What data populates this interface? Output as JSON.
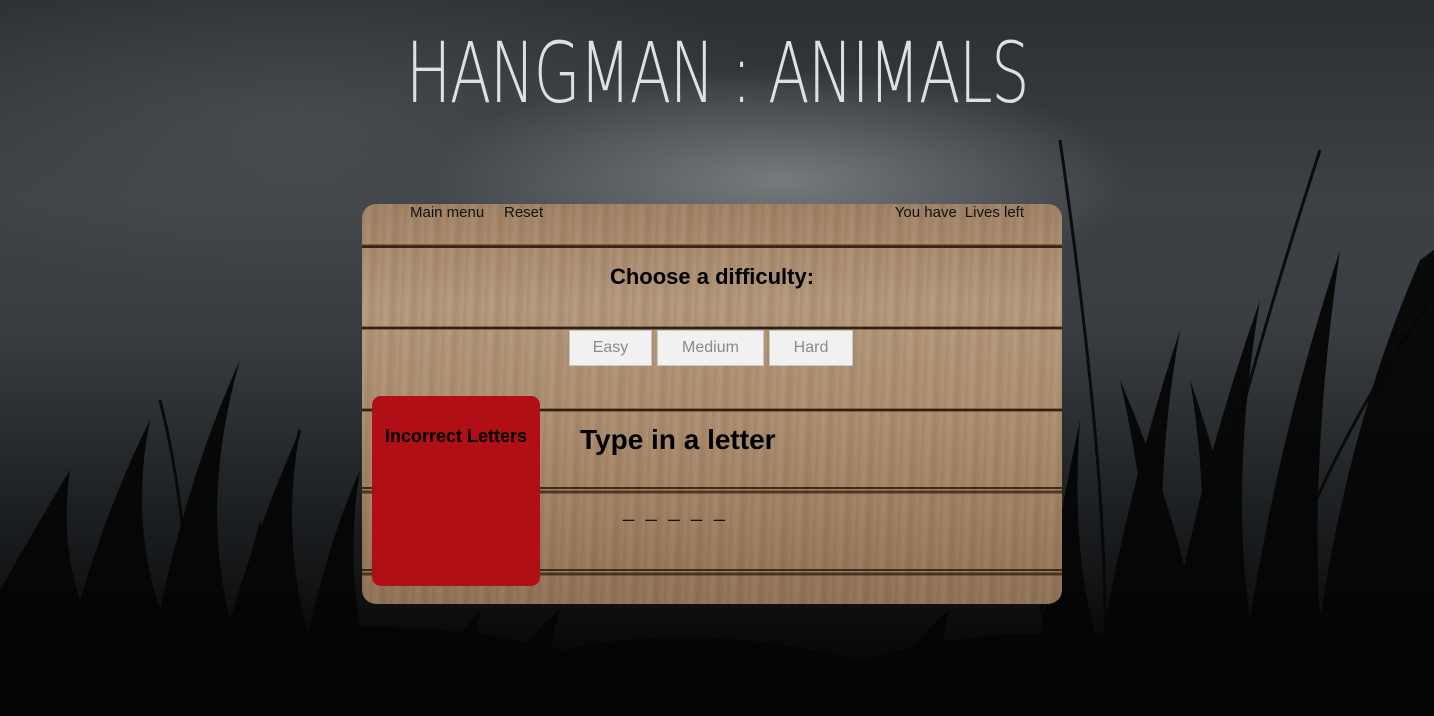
{
  "page": {
    "title": "HANGMAN : ANIMALS"
  },
  "board": {
    "nav": {
      "main_menu": "Main menu",
      "reset": "Reset"
    },
    "lives": {
      "prefix": "You have",
      "count": "",
      "suffix": "Lives left"
    },
    "difficulty": {
      "heading": "Choose a difficulty:",
      "options": [
        "Easy",
        "Medium",
        "Hard"
      ]
    },
    "incorrect": {
      "title": "Incorrect Letters",
      "letters": ""
    },
    "prompt": "Type in a letter",
    "word_blanks": "_ _ _ _ _"
  },
  "colors": {
    "incorrect_box": "#b01015",
    "lives_count": "#c0141a",
    "title": "#e0e0e0"
  }
}
